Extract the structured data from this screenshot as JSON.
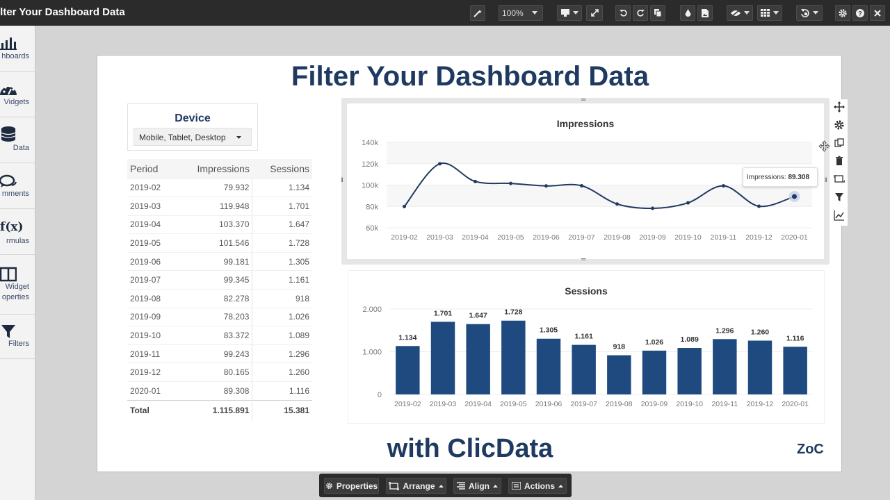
{
  "app_title": "ilter Your Dashboard Data",
  "toolbar": {
    "zoom": "100%"
  },
  "sidebar": {
    "items": [
      {
        "label": "hboards",
        "icon": "bar-chart-icon"
      },
      {
        "label": "Vidgets",
        "icon": "dashboard-gauge-icon"
      },
      {
        "label": "Data",
        "icon": "database-icon"
      },
      {
        "label": "mments",
        "icon": "comments-icon"
      },
      {
        "label": "rmulas",
        "icon": "fx-icon"
      },
      {
        "label": "Widget\noperties",
        "icon": "layout-panel-icon"
      },
      {
        "label": "Filters",
        "icon": "filter-icon"
      }
    ]
  },
  "fx_glyph": "f(x)",
  "canvas": {
    "title": "Filter Your Dashboard Data",
    "footer": "with ClicData",
    "logo": "ZoC"
  },
  "device_filter": {
    "title": "Device",
    "selected": "Mobile, Tablet, Desktop"
  },
  "table": {
    "headers": [
      "Period",
      "Impressions",
      "Sessions"
    ],
    "rows": [
      [
        "2019-02",
        "79.932",
        "1.134"
      ],
      [
        "2019-03",
        "119.948",
        "1.701"
      ],
      [
        "2019-04",
        "103.370",
        "1.647"
      ],
      [
        "2019-05",
        "101.546",
        "1.728"
      ],
      [
        "2019-06",
        "99.181",
        "1.305"
      ],
      [
        "2019-07",
        "99.345",
        "1.161"
      ],
      [
        "2019-08",
        "82.278",
        "918"
      ],
      [
        "2019-09",
        "78.203",
        "1.026"
      ],
      [
        "2019-10",
        "83.372",
        "1.089"
      ],
      [
        "2019-11",
        "99.243",
        "1.296"
      ],
      [
        "2019-12",
        "80.165",
        "1.260"
      ],
      [
        "2020-01",
        "89.308",
        "1.116"
      ]
    ],
    "total": [
      "Total",
      "1.115.891",
      "15.381"
    ]
  },
  "tooltip": {
    "label": "Impressions: ",
    "value": "89.308"
  },
  "chart_data": [
    {
      "type": "line",
      "title": "Impressions",
      "x": [
        "2019-02",
        "2019-03",
        "2019-04",
        "2019-05",
        "2019-06",
        "2019-07",
        "2019-08",
        "2019-09",
        "2019-10",
        "2019-11",
        "2019-12",
        "2020-01"
      ],
      "values": [
        79932,
        119948,
        103370,
        101546,
        99181,
        99345,
        82278,
        78203,
        83372,
        99243,
        80165,
        89308
      ],
      "ylim": [
        60000,
        140000
      ],
      "yticks": [
        60000,
        80000,
        100000,
        120000,
        140000
      ],
      "ytick_labels": [
        "60k",
        "80k",
        "100k",
        "120k",
        "140k"
      ],
      "color": "#1f3a60",
      "highlight_index": 11
    },
    {
      "type": "bar",
      "title": "Sessions",
      "categories": [
        "2019-02",
        "2019-03",
        "2019-04",
        "2019-05",
        "2019-06",
        "2019-07",
        "2019-08",
        "2019-09",
        "2019-10",
        "2019-11",
        "2019-12",
        "2020-01"
      ],
      "values": [
        1134,
        1701,
        1647,
        1728,
        1305,
        1161,
        918,
        1026,
        1089,
        1296,
        1260,
        1116
      ],
      "data_labels": [
        "1.134",
        "1.701",
        "1.647",
        "1.728",
        "1.305",
        "1.161",
        "918",
        "1.026",
        "1.089",
        "1.296",
        "1.260",
        "1.116"
      ],
      "ylim": [
        0,
        2000
      ],
      "yticks": [
        0,
        1000,
        2000
      ],
      "ytick_labels": [
        "0",
        "1.000",
        "2.000"
      ],
      "color": "#1f4a80"
    }
  ],
  "bottom_toolbar": {
    "properties": "Properties",
    "arrange": "Arrange",
    "align": "Align",
    "actions": "Actions"
  }
}
